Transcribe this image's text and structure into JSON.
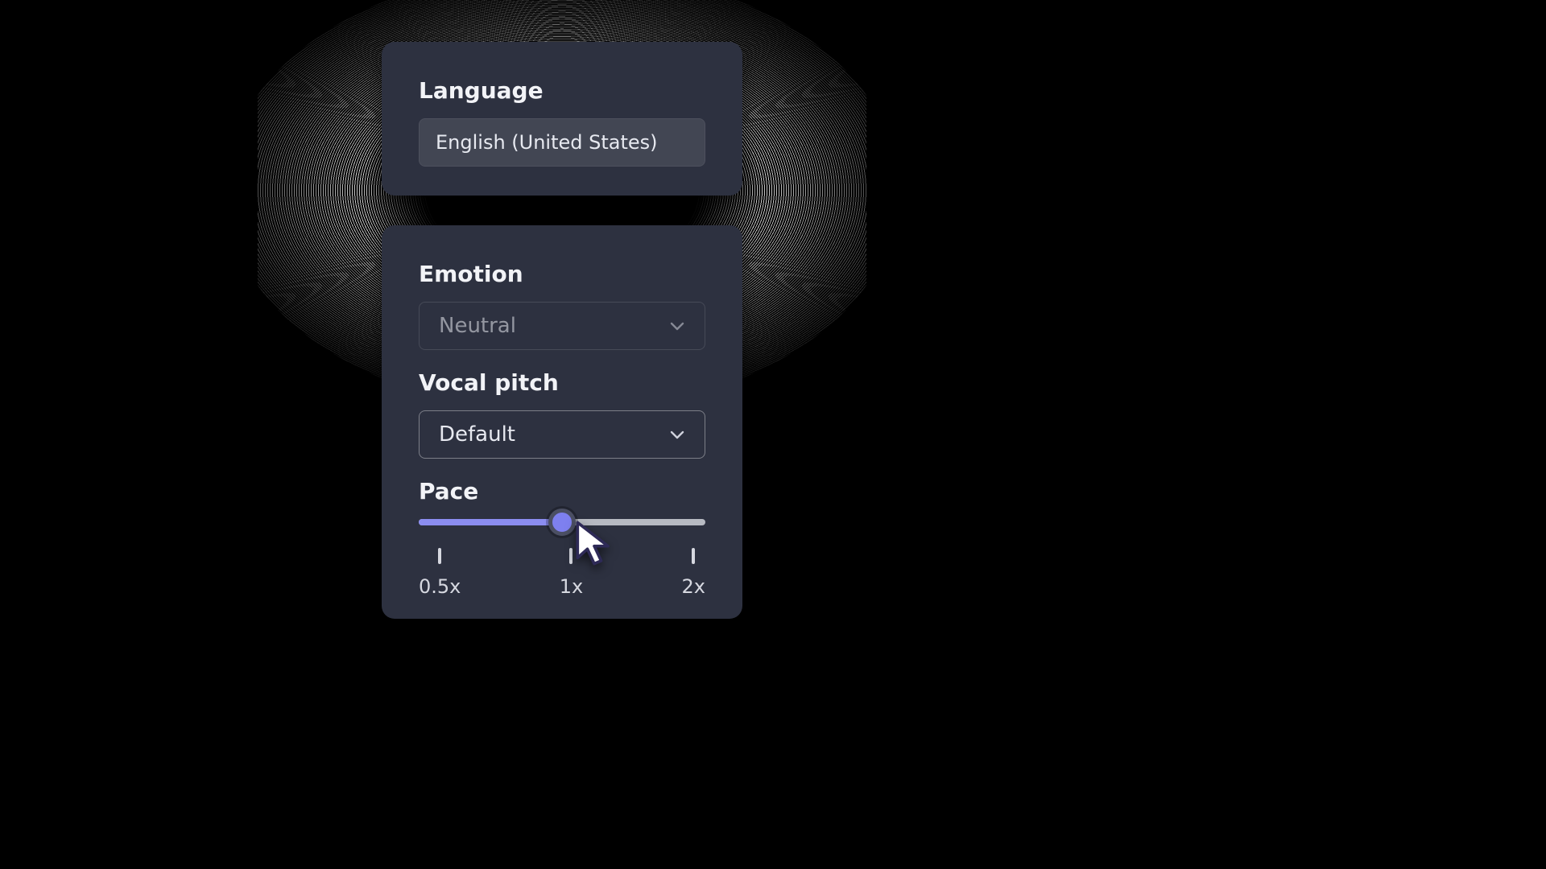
{
  "language": {
    "label": "Language",
    "value": "English (United States)"
  },
  "emotion": {
    "label": "Emotion",
    "value": "Neutral"
  },
  "pitch": {
    "label": "Vocal pitch",
    "value": "Default"
  },
  "pace": {
    "label": "Pace",
    "ticks": {
      "min": "0.5x",
      "mid": "1x",
      "max": "2x"
    },
    "value_pct": 50
  }
}
